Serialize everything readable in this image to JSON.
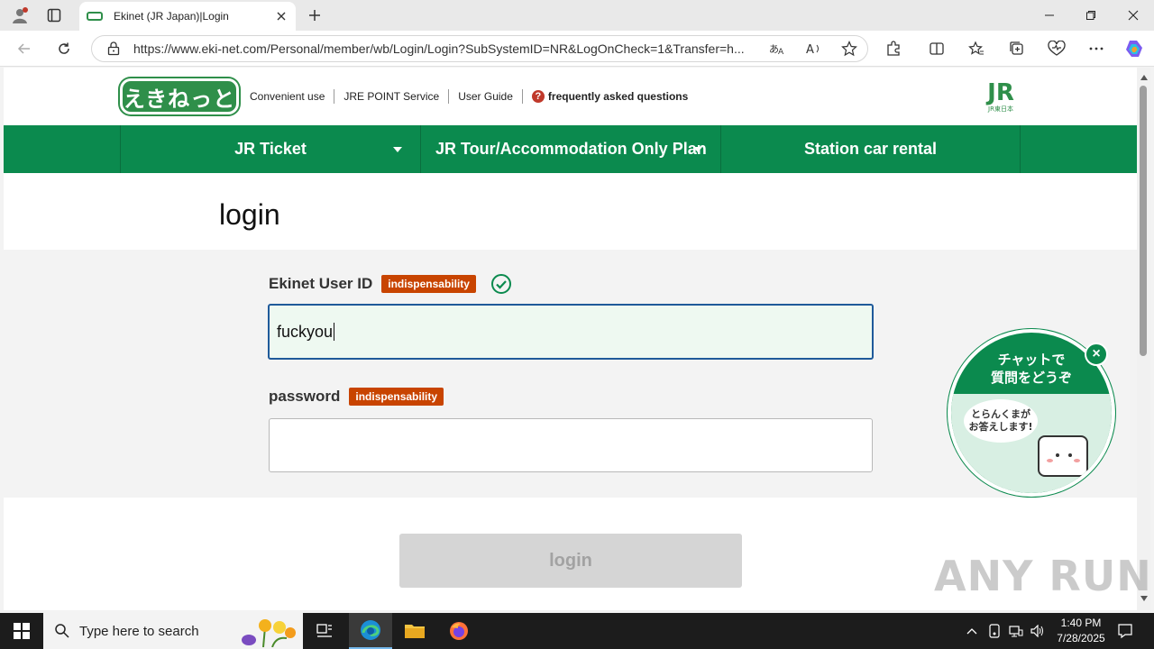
{
  "browser": {
    "tab_title": "Ekinet (JR Japan)|Login",
    "url": "https://www.eki-net.com/Personal/member/wb/Login/Login?SubSystemID=NR&LogOnCheck=1&Transfer=h..."
  },
  "header": {
    "logo_text": "えきねっと",
    "links": [
      "Convenient use",
      "JRE POINT Service",
      "User Guide"
    ],
    "faq": "frequently asked questions",
    "jr_logo": "JR",
    "jr_logo_sub": "JR東日本"
  },
  "nav": [
    {
      "label": "JR Ticket"
    },
    {
      "label": "JR Tour/Accommodation Only Plan"
    },
    {
      "label": "Station car rental"
    }
  ],
  "page": {
    "title": "login"
  },
  "form": {
    "user_id_label": "Ekinet User ID",
    "user_id_required": "indispensability",
    "user_id_value": "fuckyou",
    "password_label": "password",
    "password_required": "indispensability",
    "password_value": "",
    "login_button": "login"
  },
  "chat": {
    "title_line1": "チャットで",
    "title_line2": "質問をどうぞ",
    "bubble_line1": "とらんくまが",
    "bubble_line2": "お答えします!"
  },
  "watermark": "ANY RUN",
  "taskbar": {
    "search_placeholder": "Type here to search",
    "time": "1:40 PM",
    "date": "7/28/2025"
  },
  "colors": {
    "brand_green": "#0b8a4e",
    "required_badge": "#c84400",
    "active_input_border": "#1f5a9a"
  }
}
